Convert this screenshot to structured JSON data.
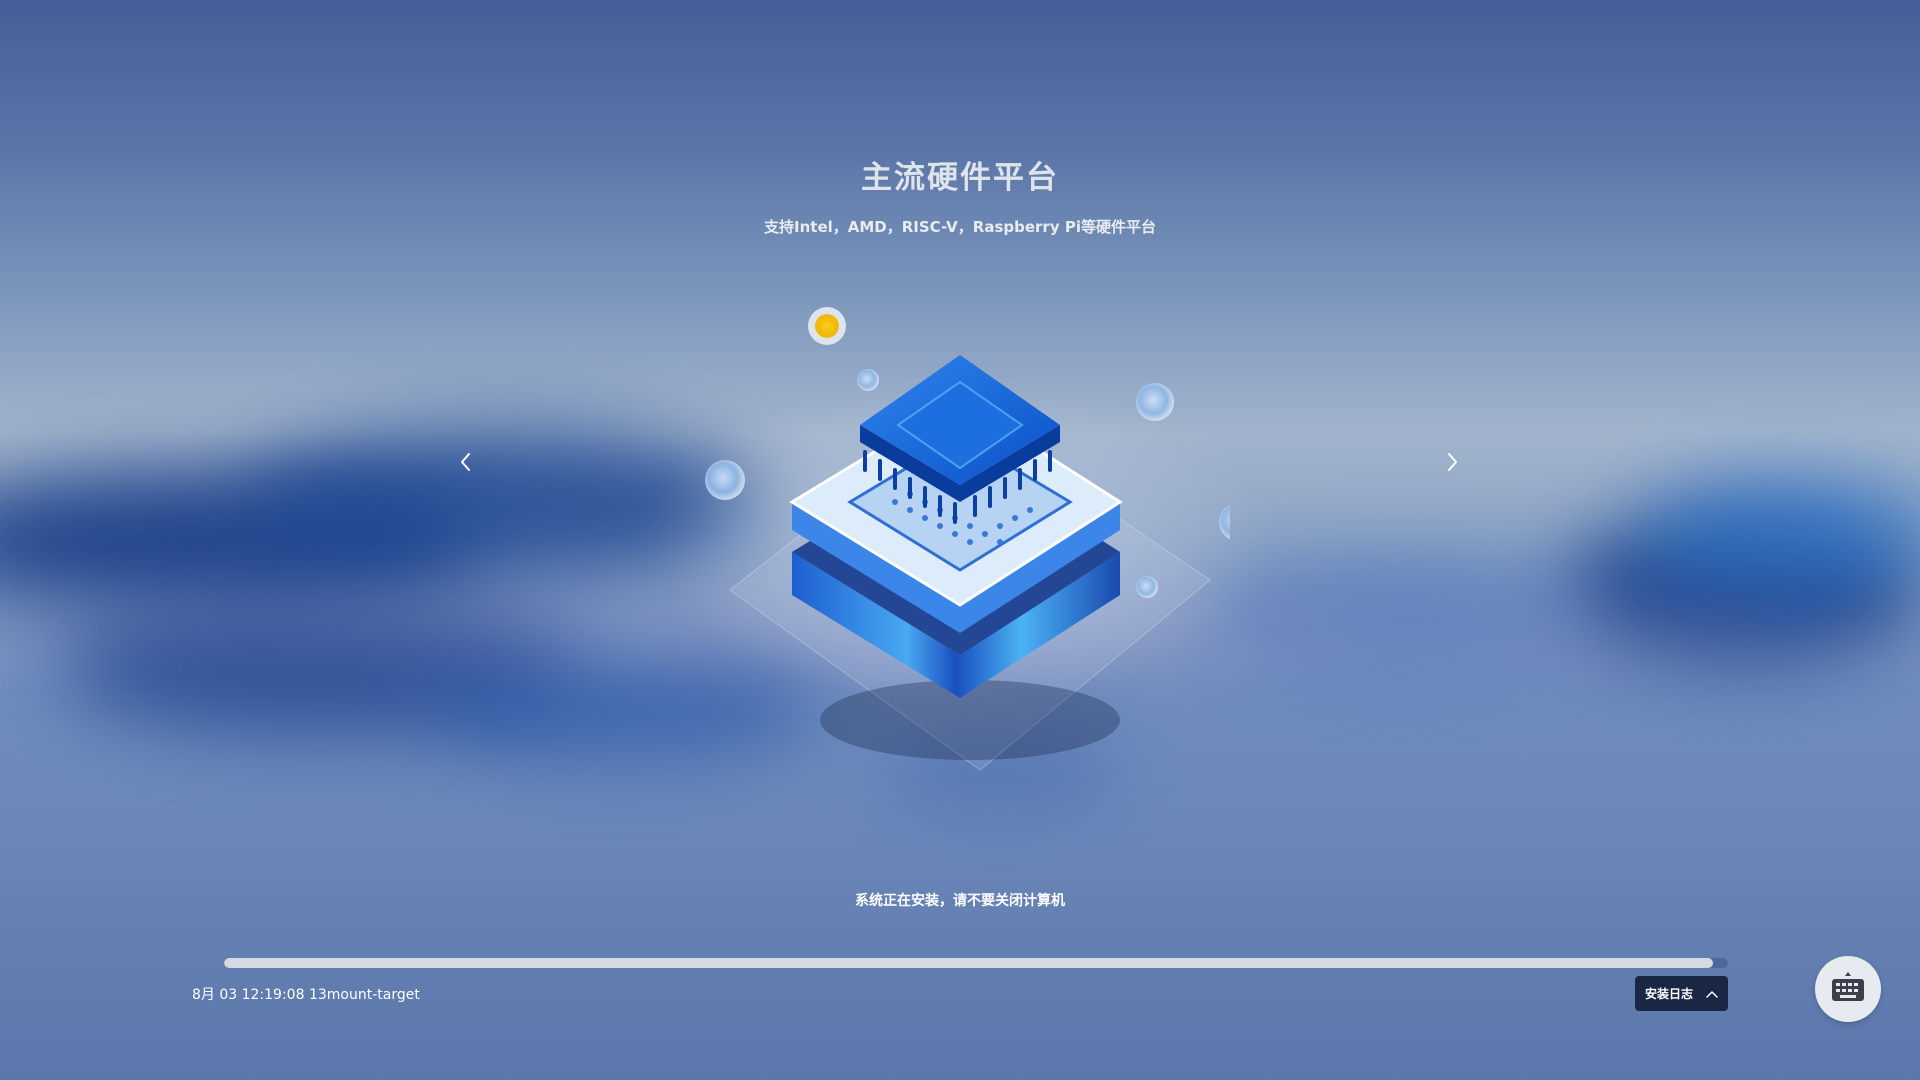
{
  "slide": {
    "title": "主流硬件平台",
    "subtitle": "支持Intel，AMD，RISC-V，Raspberry Pi等硬件平台"
  },
  "navigation": {
    "prev_icon": "chevron-left-icon",
    "next_icon": "chevron-right-icon"
  },
  "install": {
    "status_text": "系统正在安装，请不要关闭计算机",
    "progress_fraction": 0.99,
    "log_line": "8月 03 12:19:08 13mount-target",
    "log_button_label": "安装日志",
    "log_button_icon": "chevron-up-icon",
    "keyboard_icon": "keyboard-icon"
  },
  "colors": {
    "chip_blue": "#1565d8",
    "accent_yellow": "#f7c51e",
    "button_dark": "#1a2744",
    "progress_fill": "#d4d9e2"
  }
}
